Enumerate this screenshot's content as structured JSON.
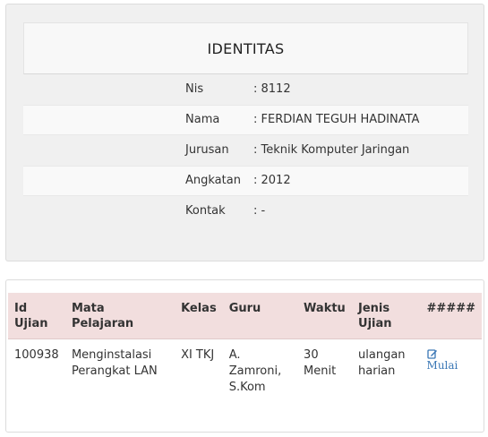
{
  "identitas": {
    "title": "IDENTITAS",
    "rows": [
      {
        "label": "Nis",
        "value": ": 8112"
      },
      {
        "label": "Nama",
        "value": ": FERDIAN TEGUH HADINATA"
      },
      {
        "label": "Jurusan",
        "value": ": Teknik Komputer Jaringan"
      },
      {
        "label": "Angkatan",
        "value": ": 2012"
      },
      {
        "label": "Kontak",
        "value": ": -"
      }
    ]
  },
  "exam_table": {
    "headers": {
      "id": "Id Ujian",
      "mapel": "Mata Pelajaran",
      "kelas": "Kelas",
      "guru": "Guru",
      "waktu": "Waktu",
      "jenis": "Jenis Ujian",
      "aksi": "#####"
    },
    "rows": [
      {
        "id": "100938",
        "mapel": "Menginstalasi Perangkat LAN",
        "kelas": "XI TKJ",
        "guru": "A. Zamroni, S.Kom",
        "waktu": "30 Menit",
        "jenis": "ulangan harian",
        "action_label": "Mulai",
        "action_icon": "edit-icon"
      }
    ]
  },
  "colors": {
    "header_bg": "#f2dede",
    "link": "#3a77b5"
  }
}
